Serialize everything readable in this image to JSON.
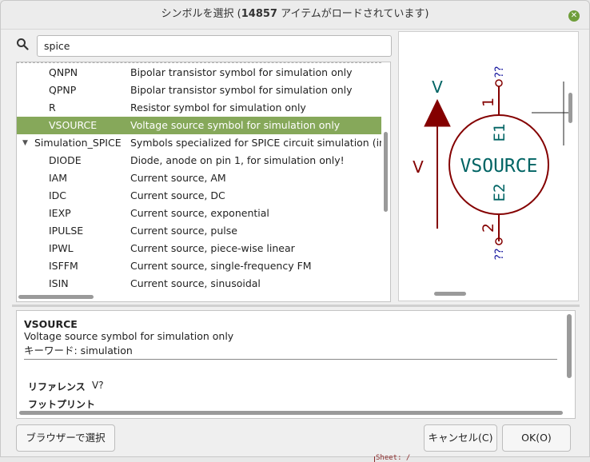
{
  "window": {
    "title_prefix": "シンボルを選択 (",
    "title_count": "14857",
    "title_suffix": " アイテムがロードされています)"
  },
  "search": {
    "value": "spice",
    "placeholder": ""
  },
  "tree": {
    "rows": [
      {
        "type": "item",
        "name": "QNPN",
        "desc": "Bipolar transistor symbol for simulation only"
      },
      {
        "type": "item",
        "name": "QPNP",
        "desc": "Bipolar transistor symbol for simulation only"
      },
      {
        "type": "item",
        "name": "R",
        "desc": "Resistor symbol for simulation only"
      },
      {
        "type": "item",
        "name": "VSOURCE",
        "desc": "Voltage source symbol for simulation only",
        "selected": true
      },
      {
        "type": "lib",
        "name": "Simulation_SPICE",
        "desc": "Symbols specialized for SPICE circuit simulation (inclu"
      },
      {
        "type": "item",
        "name": "DIODE",
        "desc": "Diode, anode on pin 1, for simulation only!"
      },
      {
        "type": "item",
        "name": "IAM",
        "desc": "Current source, AM"
      },
      {
        "type": "item",
        "name": "IDC",
        "desc": "Current source, DC"
      },
      {
        "type": "item",
        "name": "IEXP",
        "desc": "Current source, exponential"
      },
      {
        "type": "item",
        "name": "IPULSE",
        "desc": "Current source, pulse"
      },
      {
        "type": "item",
        "name": "IPWL",
        "desc": "Current source, piece-wise linear"
      },
      {
        "type": "item",
        "name": "ISFFM",
        "desc": "Current source, single-frequency FM"
      },
      {
        "type": "item",
        "name": "ISIN",
        "desc": "Current source, sinusoidal"
      }
    ]
  },
  "preview": {
    "symbol_text": "VSOURCE",
    "ref": "V",
    "arrow_label": "V",
    "pin1_num": "1",
    "pin2_num": "2",
    "pin1_name": "E1",
    "pin2_name": "E2",
    "pin_net": "??",
    "symbol_color": "#840000",
    "text_color": "#006464",
    "pin_color": "#1a1aa0"
  },
  "details": {
    "name": "VSOURCE",
    "description": "Voltage source symbol for simulation only",
    "keywords": "キーワード: simulation",
    "reference_label": "リファレンス",
    "reference_value": "V?",
    "footprint_label": "フットプリント"
  },
  "buttons": {
    "browse": "ブラウザーで選択",
    "cancel": "キャンセル(C)",
    "ok": "OK(O)"
  },
  "background": {
    "sheet_text": "Sheet: /"
  }
}
